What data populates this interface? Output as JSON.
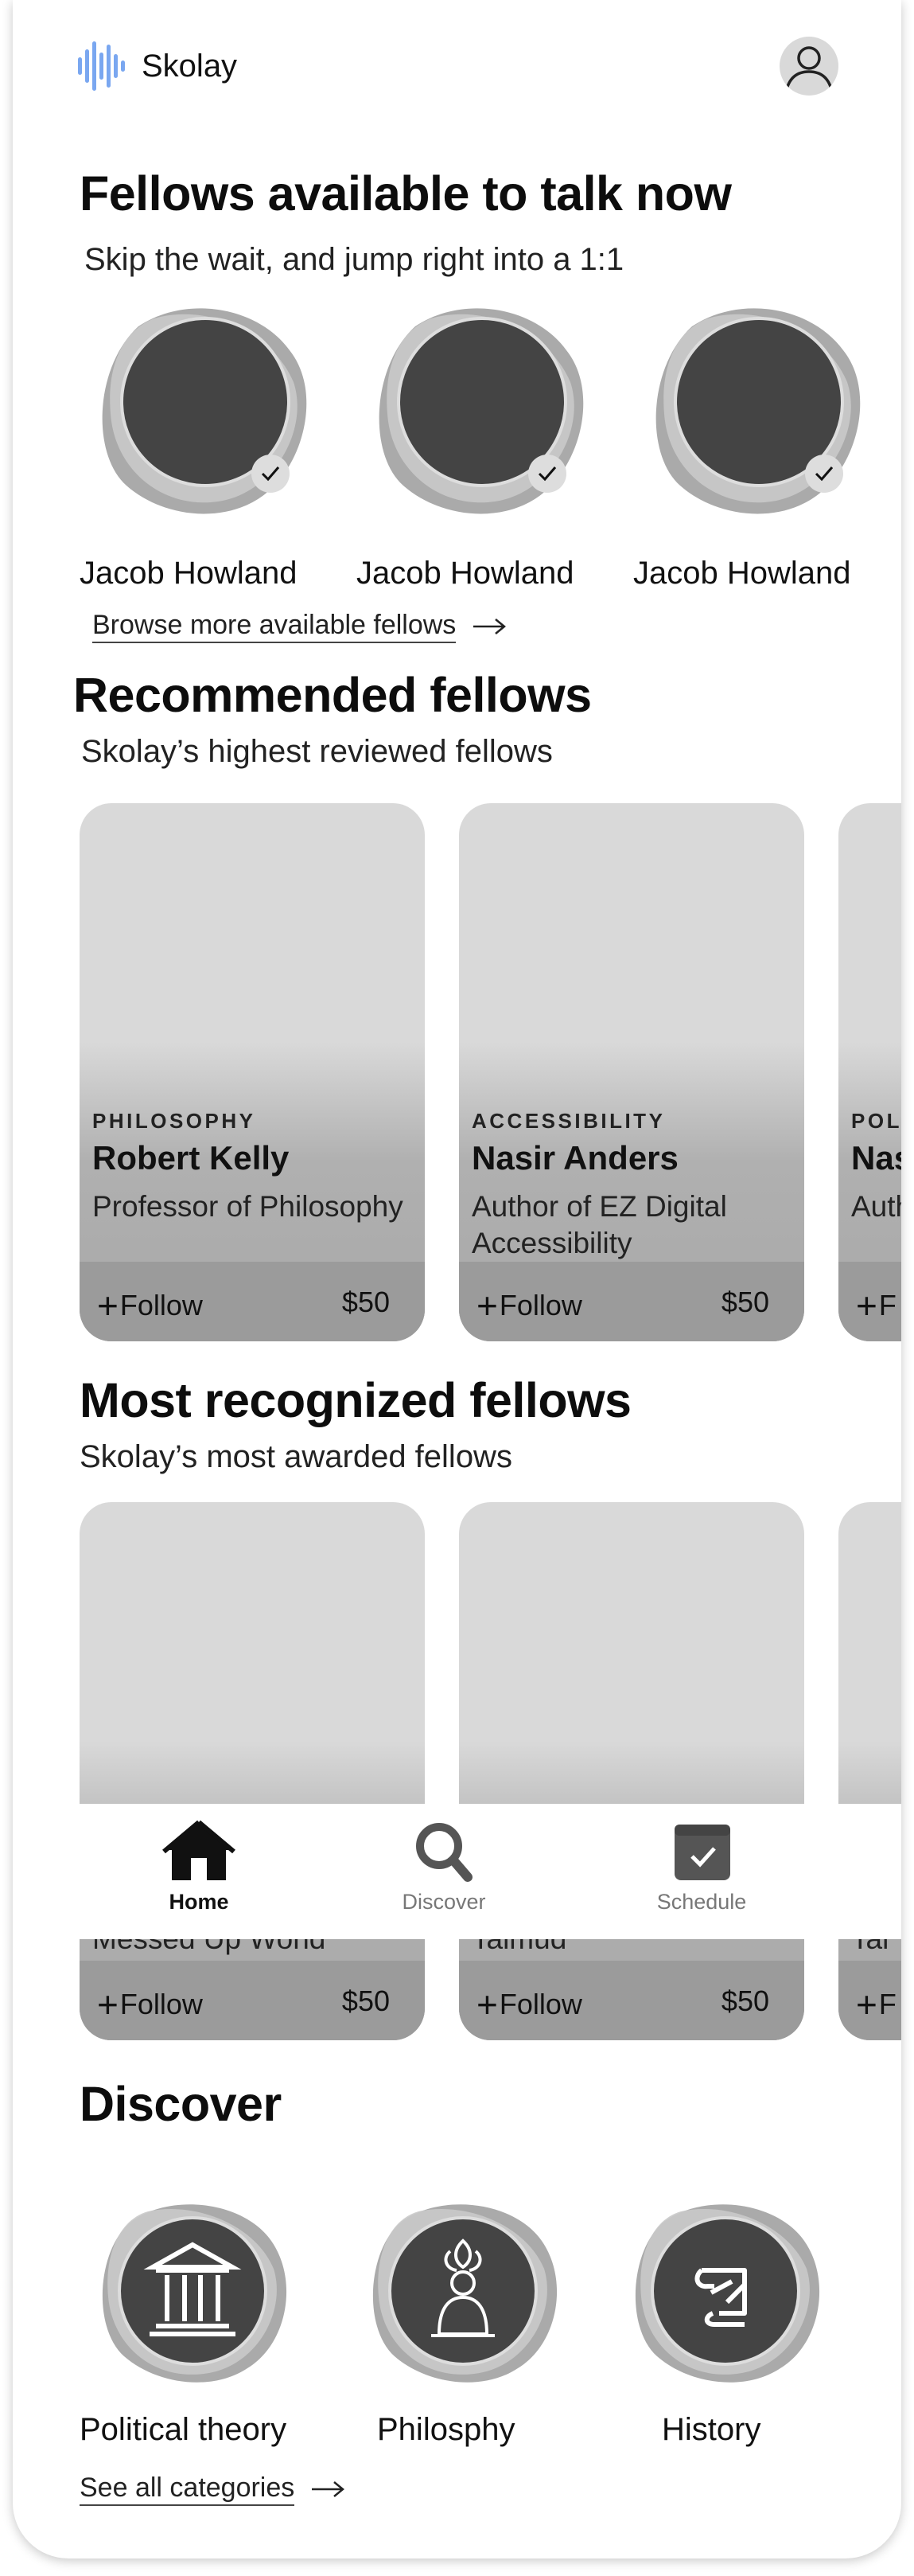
{
  "header": {
    "app_name": "Skolay"
  },
  "available": {
    "title": "Fellows available to talk now",
    "subtitle": "Skip the wait, and jump right into a 1:1",
    "fellows": [
      {
        "name": "Jacob Howland"
      },
      {
        "name": "Jacob Howland"
      },
      {
        "name": "Jacob Howland"
      }
    ],
    "browse_link": "Browse more available fellows"
  },
  "recommended": {
    "title": "Recommended fellows",
    "subtitle": "Skolay’s highest reviewed fellows",
    "cards": [
      {
        "category": "PHILOSOPHY",
        "name": "Robert Kelly",
        "role": "Professor of Philosophy",
        "follow": "Follow",
        "price": "$50"
      },
      {
        "category": "ACCESSIBILITY",
        "name": "Nasir Anders",
        "role": "Author of EZ Digital Accessibility",
        "follow": "Follow",
        "price": "$50"
      },
      {
        "category": "POLI",
        "name": "Nas",
        "role": "Auth Acc",
        "follow": "F",
        "price": ""
      }
    ]
  },
  "recognized": {
    "title": "Most recognized fellows",
    "subtitle": "Skolay’s most awarded fellows",
    "cards": [
      {
        "role": "Messed Up World",
        "follow": "Follow",
        "price": "$50"
      },
      {
        "role": "Talmud",
        "follow": "Follow",
        "price": "$50"
      },
      {
        "role": "Tal",
        "follow": "F",
        "price": ""
      }
    ]
  },
  "nav": {
    "items": [
      {
        "label": "Home",
        "icon": "home-icon",
        "active": true
      },
      {
        "label": "Discover",
        "icon": "search-icon",
        "active": false
      },
      {
        "label": "Schedule",
        "icon": "calendar-icon",
        "active": false
      }
    ]
  },
  "discover": {
    "title": "Discover",
    "categories": [
      {
        "name": "Political theory",
        "icon": "courthouse-icon"
      },
      {
        "name": "Philosphy",
        "icon": "meditation-icon"
      },
      {
        "name": "History",
        "icon": "scroll-icon"
      }
    ],
    "see_all": "See all categories"
  },
  "colors": {
    "accent_logo": "#7aa7f0",
    "card_bg": "#d9d9d9",
    "card_footer": "#9b9b9b",
    "avatar_dark": "#444444",
    "blob_gray": "#aaaaaa"
  }
}
